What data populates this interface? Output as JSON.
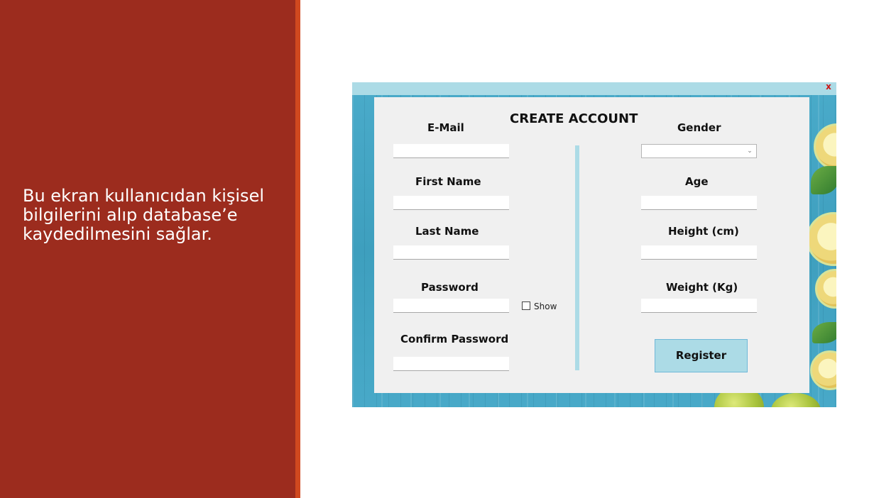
{
  "slide": {
    "description": "Bu ekran kullanıcıdan kişisel bilgilerini alıp database’e kaydedilmesini sağlar."
  },
  "window": {
    "close_label": "x",
    "heading": "CREATE ACCOUNT"
  },
  "form": {
    "email_label": "E-Mail",
    "email_value": "",
    "first_name_label": "First Name",
    "first_name_value": "",
    "last_name_label": "Last Name",
    "last_name_value": "",
    "password_label": "Password",
    "password_value": "",
    "show_label": "Show",
    "show_checked": false,
    "confirm_password_label": "Confirm Password",
    "confirm_password_value": "",
    "gender_label": "Gender",
    "gender_value": "",
    "age_label": "Age",
    "age_value": "",
    "height_label": "Height (cm)",
    "height_value": "",
    "weight_label": "Weight (Kg)",
    "weight_value": "",
    "register_label": "Register"
  },
  "icons": {
    "combo_arrow": "chevron-down-icon",
    "checkbox": "checkbox-icon"
  },
  "colors": {
    "slide_panel": "#9c2c1e",
    "slide_accent": "#d0491f",
    "title_bar": "#acdbe6",
    "form_background": "#f0f0f0",
    "register_button": "#acdbe6",
    "close_button": "#cc1414"
  }
}
